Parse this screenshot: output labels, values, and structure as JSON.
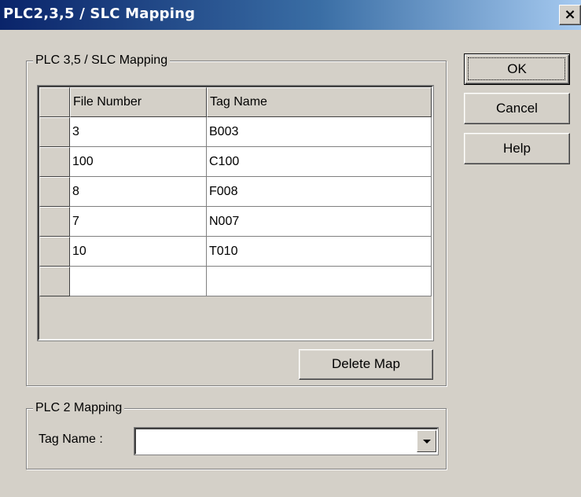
{
  "window": {
    "title": "PLC2,3,5 / SLC Mapping",
    "close_glyph": "✕"
  },
  "slc_group": {
    "legend": "PLC 3,5 / SLC Mapping",
    "columns": [
      "File Number",
      "Tag Name"
    ],
    "rows": [
      {
        "file_number": "3",
        "tag_name": "B003"
      },
      {
        "file_number": "100",
        "tag_name": "C100"
      },
      {
        "file_number": "8",
        "tag_name": "F008"
      },
      {
        "file_number": "7",
        "tag_name": "N007"
      },
      {
        "file_number": "10",
        "tag_name": "T010"
      },
      {
        "file_number": "",
        "tag_name": ""
      }
    ],
    "delete_label": "Delete Map"
  },
  "plc2_group": {
    "legend": "PLC 2 Mapping",
    "tag_label": "Tag Name :",
    "tag_value": ""
  },
  "buttons": {
    "ok": "OK",
    "cancel": "Cancel",
    "help": "Help"
  }
}
